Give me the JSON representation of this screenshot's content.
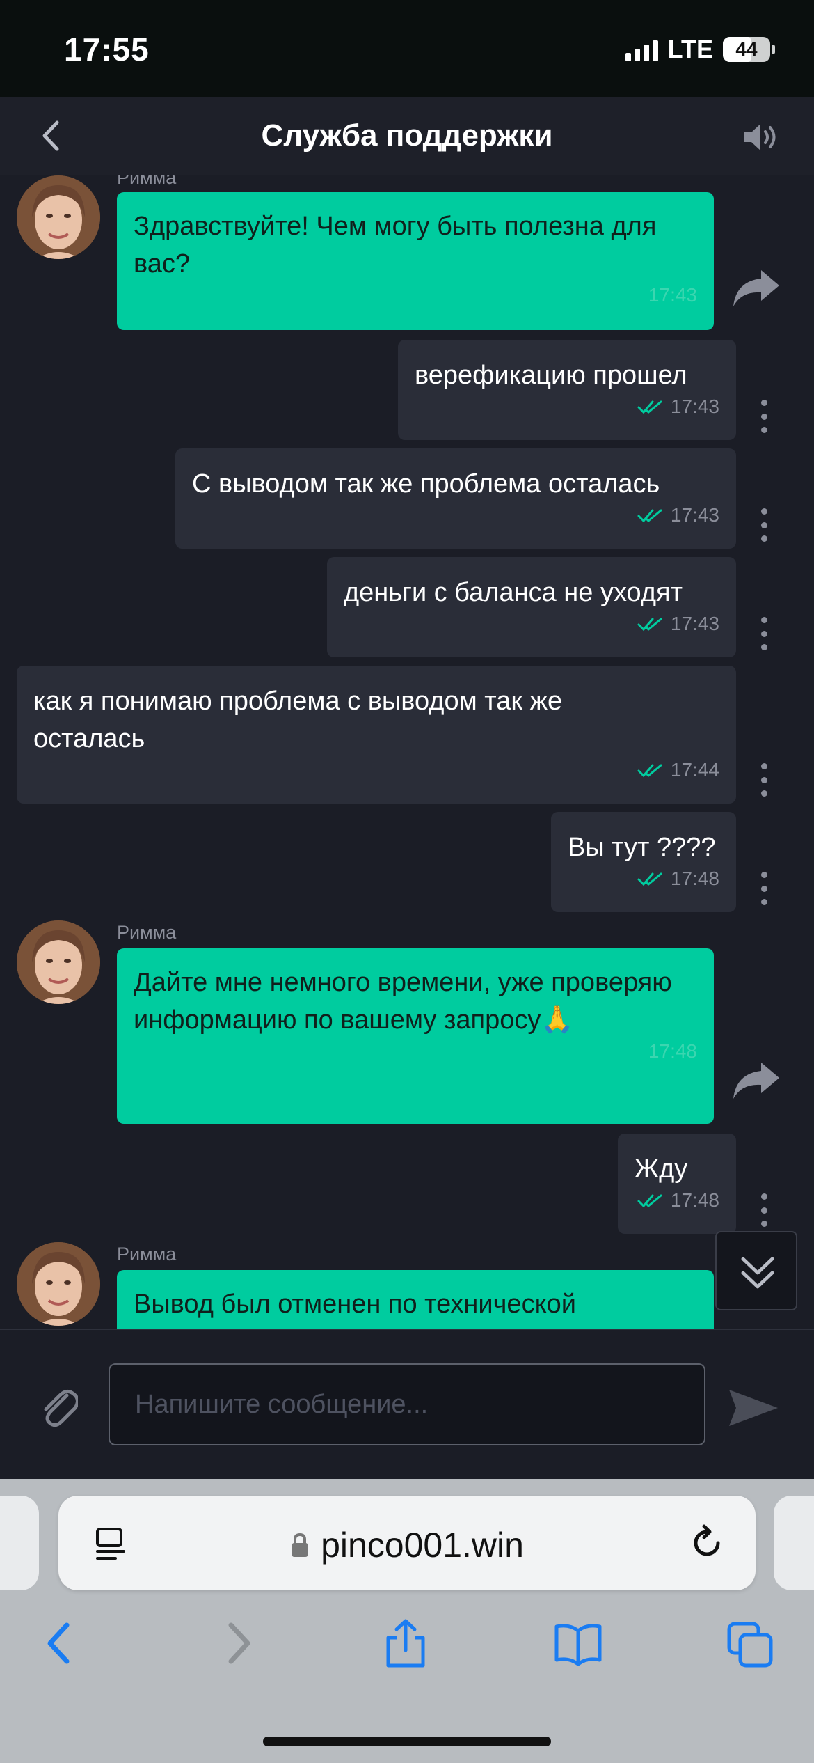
{
  "status_bar": {
    "time": "17:55",
    "network": "LTE",
    "battery": "44"
  },
  "header": {
    "title": "Служба поддержки",
    "back_icon": "chevron-left-icon",
    "sound_icon": "speaker-icon"
  },
  "messages": [
    {
      "direction": "in",
      "sender": "Римма",
      "text": "Здравствуйте! Чем могу быть полезна для вас?",
      "time": "17:43"
    },
    {
      "direction": "out",
      "text": "верефикацию прошел",
      "time": "17:43"
    },
    {
      "direction": "out",
      "text": "С выводом так же проблема осталась",
      "time": "17:43"
    },
    {
      "direction": "out",
      "text": "деньги с баланса не уходят",
      "time": "17:43"
    },
    {
      "direction": "out",
      "text": "как я понимаю проблема с выводом так же осталась",
      "time": "17:44"
    },
    {
      "direction": "out",
      "text": "Вы тут ????",
      "time": "17:48"
    },
    {
      "direction": "in",
      "sender": "Римма",
      "text": "Дайте мне немного времени, уже проверяю информацию по вашему запросу🙏",
      "time": "17:48"
    },
    {
      "direction": "out",
      "text": "Жду",
      "time": "17:48"
    },
    {
      "direction": "in",
      "sender": "Римма",
      "text": "Вывод был отменен по технической",
      "time": ""
    }
  ],
  "composer": {
    "placeholder": "Напишите сообщение...",
    "value": ""
  },
  "browser": {
    "url": "pinco001.win"
  },
  "colors": {
    "accent": "#00cc9f",
    "background": "#1b1d26",
    "bubble_out": "#2a2d38",
    "safari_blue": "#1a7cf2"
  }
}
